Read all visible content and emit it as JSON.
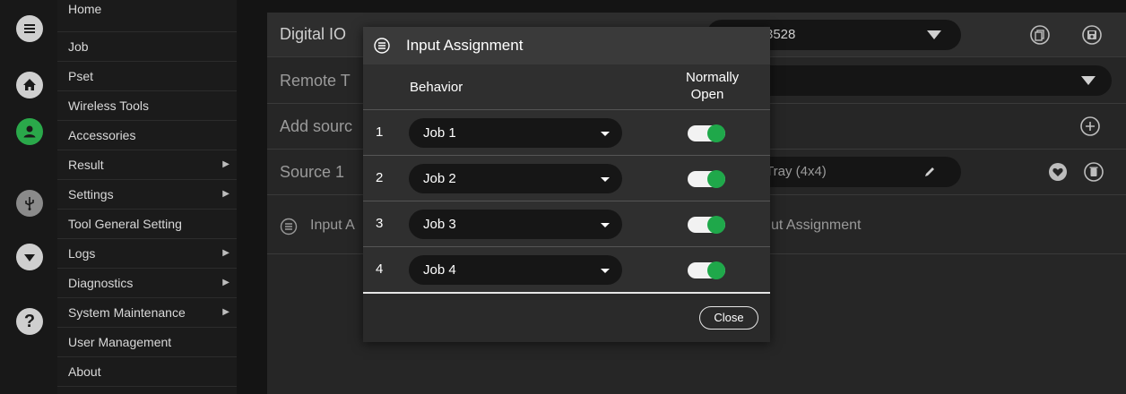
{
  "menu": {
    "items": [
      {
        "label": "Home",
        "submenu": false
      },
      {
        "label": "Job",
        "submenu": false
      },
      {
        "label": "Pset",
        "submenu": false
      },
      {
        "label": "Wireless Tools",
        "submenu": false
      },
      {
        "label": "Accessories",
        "submenu": false
      },
      {
        "label": "Result",
        "submenu": true
      },
      {
        "label": "Settings",
        "submenu": true
      },
      {
        "label": "Tool General Setting",
        "submenu": false
      },
      {
        "label": "Logs",
        "submenu": true
      },
      {
        "label": "Diagnostics",
        "submenu": true
      },
      {
        "label": "System Maintenance",
        "submenu": true
      },
      {
        "label": "User Management",
        "submenu": false
      },
      {
        "label": "About",
        "submenu": false
      }
    ],
    "arrow_glyph": "▶"
  },
  "rail": {
    "icons": [
      "hamburger-icon",
      "home-icon",
      "user-icon",
      "usb-icon",
      "dropdown-icon",
      "help-icon"
    ],
    "help_glyph": "?"
  },
  "background": {
    "row0_label": "Digital IO",
    "row0_value": "3528",
    "row1_label": "Remote T",
    "row2_label": "Add sourc",
    "row3_label": "Source 1",
    "row3_value": "Tray (4x4)",
    "row4_left": "Input A",
    "row4_right": "ut Assignment"
  },
  "modal": {
    "title": "Input Assignment",
    "col_behavior": "Behavior",
    "col_normally": "Normally",
    "col_open": "Open",
    "rows": [
      {
        "num": "1",
        "behavior": "Job 1",
        "normally_open": true
      },
      {
        "num": "2",
        "behavior": "Job 2",
        "normally_open": true
      },
      {
        "num": "3",
        "behavior": "Job 3",
        "normally_open": true
      },
      {
        "num": "4",
        "behavior": "Job 4",
        "normally_open": true
      }
    ],
    "close_label": "Close"
  },
  "colors": {
    "accent_green": "#1fa84a",
    "background": "#141414",
    "modal": "#2f2f2f"
  }
}
